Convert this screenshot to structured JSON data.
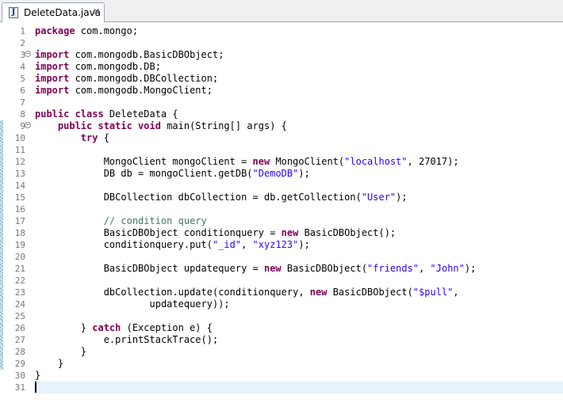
{
  "tab": {
    "title": "DeleteData.java",
    "close": "✕"
  },
  "lines": [
    {
      "n": "1",
      "code": [
        {
          "t": "kw",
          "v": "package"
        },
        {
          "t": "p",
          "v": " com.mongo;"
        }
      ]
    },
    {
      "n": "2",
      "code": []
    },
    {
      "n": "3",
      "fold": "−",
      "code": [
        {
          "t": "kw",
          "v": "import"
        },
        {
          "t": "p",
          "v": " com.mongodb.BasicDBObject;"
        }
      ]
    },
    {
      "n": "4",
      "code": [
        {
          "t": "kw",
          "v": "import"
        },
        {
          "t": "p",
          "v": " com.mongodb.DB;"
        }
      ]
    },
    {
      "n": "5",
      "code": [
        {
          "t": "kw",
          "v": "import"
        },
        {
          "t": "p",
          "v": " com.mongodb.DBCollection;"
        }
      ]
    },
    {
      "n": "6",
      "code": [
        {
          "t": "kw",
          "v": "import"
        },
        {
          "t": "p",
          "v": " com.mongodb.MongoClient;"
        }
      ]
    },
    {
      "n": "7",
      "code": []
    },
    {
      "n": "8",
      "code": [
        {
          "t": "kw",
          "v": "public class"
        },
        {
          "t": "p",
          "v": " DeleteData {"
        }
      ]
    },
    {
      "n": "9",
      "fold": "−",
      "mark": true,
      "code": [
        {
          "t": "p",
          "v": "    "
        },
        {
          "t": "kw",
          "v": "public static void"
        },
        {
          "t": "p",
          "v": " main(String[] args) {"
        }
      ]
    },
    {
      "n": "10",
      "mark": true,
      "code": [
        {
          "t": "p",
          "v": "        "
        },
        {
          "t": "kw",
          "v": "try"
        },
        {
          "t": "p",
          "v": " {"
        }
      ]
    },
    {
      "n": "11",
      "mark": true,
      "code": []
    },
    {
      "n": "12",
      "mark": true,
      "code": [
        {
          "t": "p",
          "v": "            MongoClient mongoClient = "
        },
        {
          "t": "kw",
          "v": "new"
        },
        {
          "t": "p",
          "v": " MongoClient("
        },
        {
          "t": "str",
          "v": "\"localhost\""
        },
        {
          "t": "p",
          "v": ", 27017);"
        }
      ]
    },
    {
      "n": "13",
      "mark": true,
      "code": [
        {
          "t": "p",
          "v": "            DB db = mongoClient.getDB("
        },
        {
          "t": "str",
          "v": "\"DemoDB\""
        },
        {
          "t": "p",
          "v": ");"
        }
      ]
    },
    {
      "n": "14",
      "mark": true,
      "code": []
    },
    {
      "n": "15",
      "mark": true,
      "code": [
        {
          "t": "p",
          "v": "            DBCollection dbCollection = db.getCollection("
        },
        {
          "t": "str",
          "v": "\"User\""
        },
        {
          "t": "p",
          "v": ");"
        }
      ]
    },
    {
      "n": "16",
      "mark": true,
      "code": []
    },
    {
      "n": "17",
      "mark": true,
      "code": [
        {
          "t": "com",
          "v": "            // condition query"
        }
      ]
    },
    {
      "n": "18",
      "mark": true,
      "code": [
        {
          "t": "p",
          "v": "            BasicDBObject conditionquery = "
        },
        {
          "t": "kw",
          "v": "new"
        },
        {
          "t": "p",
          "v": " BasicDBObject();"
        }
      ]
    },
    {
      "n": "19",
      "mark": true,
      "code": [
        {
          "t": "p",
          "v": "            conditionquery.put("
        },
        {
          "t": "str",
          "v": "\"_id\""
        },
        {
          "t": "p",
          "v": ", "
        },
        {
          "t": "str",
          "v": "\"xyz123\""
        },
        {
          "t": "p",
          "v": ");"
        }
      ]
    },
    {
      "n": "20",
      "mark": true,
      "code": []
    },
    {
      "n": "21",
      "mark": true,
      "code": [
        {
          "t": "p",
          "v": "            BasicDBObject updatequery = "
        },
        {
          "t": "kw",
          "v": "new"
        },
        {
          "t": "p",
          "v": " BasicDBObject("
        },
        {
          "t": "str",
          "v": "\"friends\""
        },
        {
          "t": "p",
          "v": ", "
        },
        {
          "t": "str",
          "v": "\"John\""
        },
        {
          "t": "p",
          "v": ");"
        }
      ]
    },
    {
      "n": "22",
      "mark": true,
      "code": []
    },
    {
      "n": "23",
      "mark": true,
      "code": [
        {
          "t": "p",
          "v": "            dbCollection.update(conditionquery, "
        },
        {
          "t": "kw",
          "v": "new"
        },
        {
          "t": "p",
          "v": " BasicDBObject("
        },
        {
          "t": "str",
          "v": "\"$pull\""
        },
        {
          "t": "p",
          "v": ","
        }
      ]
    },
    {
      "n": "24",
      "mark": true,
      "code": [
        {
          "t": "p",
          "v": "                    updatequery));"
        }
      ]
    },
    {
      "n": "25",
      "mark": true,
      "code": []
    },
    {
      "n": "26",
      "mark": true,
      "code": [
        {
          "t": "p",
          "v": "        } "
        },
        {
          "t": "kw",
          "v": "catch"
        },
        {
          "t": "p",
          "v": " (Exception e) {"
        }
      ]
    },
    {
      "n": "27",
      "mark": true,
      "code": [
        {
          "t": "p",
          "v": "            e.printStackTrace();"
        }
      ]
    },
    {
      "n": "28",
      "mark": true,
      "code": [
        {
          "t": "p",
          "v": "        }"
        }
      ]
    },
    {
      "n": "29",
      "mark": true,
      "code": [
        {
          "t": "p",
          "v": "    }"
        }
      ]
    },
    {
      "n": "30",
      "code": [
        {
          "t": "p",
          "v": "}"
        }
      ]
    },
    {
      "n": "31",
      "current": true,
      "code": []
    }
  ]
}
